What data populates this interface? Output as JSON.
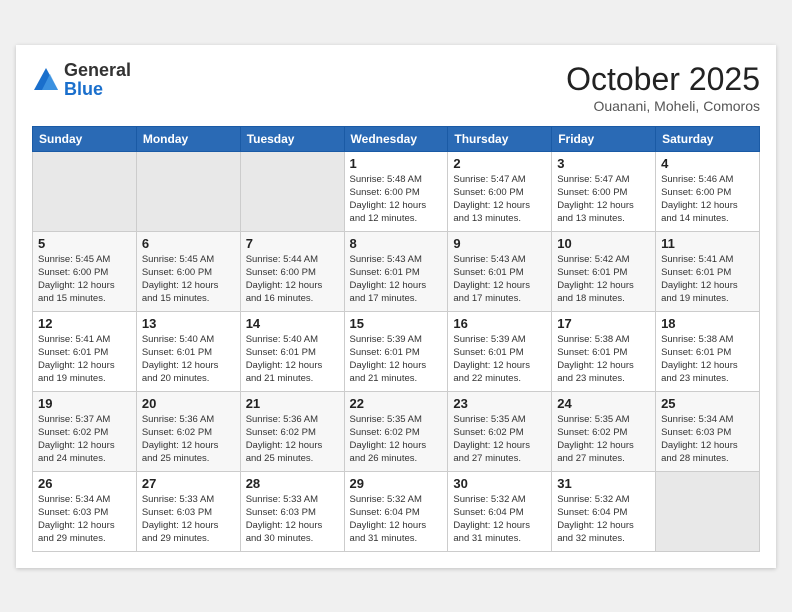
{
  "header": {
    "logo": {
      "line1": "General",
      "line2": "Blue"
    },
    "title": "October 2025",
    "location": "Ouanani, Moheli, Comoros"
  },
  "weekdays": [
    "Sunday",
    "Monday",
    "Tuesday",
    "Wednesday",
    "Thursday",
    "Friday",
    "Saturday"
  ],
  "weeks": [
    [
      {
        "day": "",
        "info": ""
      },
      {
        "day": "",
        "info": ""
      },
      {
        "day": "",
        "info": ""
      },
      {
        "day": "1",
        "info": "Sunrise: 5:48 AM\nSunset: 6:00 PM\nDaylight: 12 hours\nand 12 minutes."
      },
      {
        "day": "2",
        "info": "Sunrise: 5:47 AM\nSunset: 6:00 PM\nDaylight: 12 hours\nand 13 minutes."
      },
      {
        "day": "3",
        "info": "Sunrise: 5:47 AM\nSunset: 6:00 PM\nDaylight: 12 hours\nand 13 minutes."
      },
      {
        "day": "4",
        "info": "Sunrise: 5:46 AM\nSunset: 6:00 PM\nDaylight: 12 hours\nand 14 minutes."
      }
    ],
    [
      {
        "day": "5",
        "info": "Sunrise: 5:45 AM\nSunset: 6:00 PM\nDaylight: 12 hours\nand 15 minutes."
      },
      {
        "day": "6",
        "info": "Sunrise: 5:45 AM\nSunset: 6:00 PM\nDaylight: 12 hours\nand 15 minutes."
      },
      {
        "day": "7",
        "info": "Sunrise: 5:44 AM\nSunset: 6:00 PM\nDaylight: 12 hours\nand 16 minutes."
      },
      {
        "day": "8",
        "info": "Sunrise: 5:43 AM\nSunset: 6:01 PM\nDaylight: 12 hours\nand 17 minutes."
      },
      {
        "day": "9",
        "info": "Sunrise: 5:43 AM\nSunset: 6:01 PM\nDaylight: 12 hours\nand 17 minutes."
      },
      {
        "day": "10",
        "info": "Sunrise: 5:42 AM\nSunset: 6:01 PM\nDaylight: 12 hours\nand 18 minutes."
      },
      {
        "day": "11",
        "info": "Sunrise: 5:41 AM\nSunset: 6:01 PM\nDaylight: 12 hours\nand 19 minutes."
      }
    ],
    [
      {
        "day": "12",
        "info": "Sunrise: 5:41 AM\nSunset: 6:01 PM\nDaylight: 12 hours\nand 19 minutes."
      },
      {
        "day": "13",
        "info": "Sunrise: 5:40 AM\nSunset: 6:01 PM\nDaylight: 12 hours\nand 20 minutes."
      },
      {
        "day": "14",
        "info": "Sunrise: 5:40 AM\nSunset: 6:01 PM\nDaylight: 12 hours\nand 21 minutes."
      },
      {
        "day": "15",
        "info": "Sunrise: 5:39 AM\nSunset: 6:01 PM\nDaylight: 12 hours\nand 21 minutes."
      },
      {
        "day": "16",
        "info": "Sunrise: 5:39 AM\nSunset: 6:01 PM\nDaylight: 12 hours\nand 22 minutes."
      },
      {
        "day": "17",
        "info": "Sunrise: 5:38 AM\nSunset: 6:01 PM\nDaylight: 12 hours\nand 23 minutes."
      },
      {
        "day": "18",
        "info": "Sunrise: 5:38 AM\nSunset: 6:01 PM\nDaylight: 12 hours\nand 23 minutes."
      }
    ],
    [
      {
        "day": "19",
        "info": "Sunrise: 5:37 AM\nSunset: 6:02 PM\nDaylight: 12 hours\nand 24 minutes."
      },
      {
        "day": "20",
        "info": "Sunrise: 5:36 AM\nSunset: 6:02 PM\nDaylight: 12 hours\nand 25 minutes."
      },
      {
        "day": "21",
        "info": "Sunrise: 5:36 AM\nSunset: 6:02 PM\nDaylight: 12 hours\nand 25 minutes."
      },
      {
        "day": "22",
        "info": "Sunrise: 5:35 AM\nSunset: 6:02 PM\nDaylight: 12 hours\nand 26 minutes."
      },
      {
        "day": "23",
        "info": "Sunrise: 5:35 AM\nSunset: 6:02 PM\nDaylight: 12 hours\nand 27 minutes."
      },
      {
        "day": "24",
        "info": "Sunrise: 5:35 AM\nSunset: 6:02 PM\nDaylight: 12 hours\nand 27 minutes."
      },
      {
        "day": "25",
        "info": "Sunrise: 5:34 AM\nSunset: 6:03 PM\nDaylight: 12 hours\nand 28 minutes."
      }
    ],
    [
      {
        "day": "26",
        "info": "Sunrise: 5:34 AM\nSunset: 6:03 PM\nDaylight: 12 hours\nand 29 minutes."
      },
      {
        "day": "27",
        "info": "Sunrise: 5:33 AM\nSunset: 6:03 PM\nDaylight: 12 hours\nand 29 minutes."
      },
      {
        "day": "28",
        "info": "Sunrise: 5:33 AM\nSunset: 6:03 PM\nDaylight: 12 hours\nand 30 minutes."
      },
      {
        "day": "29",
        "info": "Sunrise: 5:32 AM\nSunset: 6:04 PM\nDaylight: 12 hours\nand 31 minutes."
      },
      {
        "day": "30",
        "info": "Sunrise: 5:32 AM\nSunset: 6:04 PM\nDaylight: 12 hours\nand 31 minutes."
      },
      {
        "day": "31",
        "info": "Sunrise: 5:32 AM\nSunset: 6:04 PM\nDaylight: 12 hours\nand 32 minutes."
      },
      {
        "day": "",
        "info": ""
      }
    ]
  ]
}
